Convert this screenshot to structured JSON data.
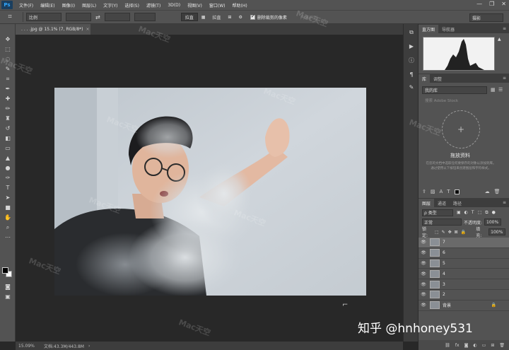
{
  "app": {
    "logo": "Ps"
  },
  "menu": [
    "文件(F)",
    "编辑(E)",
    "图像(I)",
    "图层(L)",
    "文字(Y)",
    "选择(S)",
    "滤镜(T)",
    "3D(D)",
    "视图(V)",
    "窗口(W)",
    "帮助(H)"
  ],
  "window_controls": [
    "—",
    "❐",
    "✕"
  ],
  "options": {
    "ratio_label": "比例",
    "straighten": "拉直",
    "overlay": "拉直",
    "delete_cropped": "删除裁剪的像素",
    "content_aware": "内容识别",
    "workspace": "摄影"
  },
  "document": {
    "tab_title": "  . . . .jpg @ 15.1% (7, RGB/8*)",
    "tab_close": "×",
    "zoom": "15.09%",
    "info": "文档:43.3M/443.8M"
  },
  "panels": {
    "histogram_tabs": [
      "直方图",
      "导航器"
    ],
    "library_tabs": [
      "库",
      "调整"
    ],
    "library_select": "我的库",
    "library_search": "搜索 Adobe Stock",
    "library_title": "拖放资料",
    "library_desc": "在您的文档中选取任何要保存的对象以添加到库。通过使用以下按钮来创建图层和字符样式。",
    "layers_tabs": [
      "图层",
      "通道",
      "路径"
    ],
    "filter_label": "ρ 类型",
    "blend_mode": "正常",
    "opacity_label": "不透明度:",
    "opacity_value": "100%",
    "lock_label": "锁定:",
    "fill_label": "填充:",
    "fill_value": "100%",
    "layers": [
      {
        "name": "7",
        "selected": true
      },
      {
        "name": "6",
        "selected": false
      },
      {
        "name": "5",
        "selected": false
      },
      {
        "name": "4",
        "selected": false
      },
      {
        "name": "3",
        "selected": false
      },
      {
        "name": "2",
        "selected": false
      },
      {
        "name": "背景",
        "selected": false
      }
    ]
  },
  "watermark": "Mac天空",
  "credit": "知乎 @hnhoney531"
}
